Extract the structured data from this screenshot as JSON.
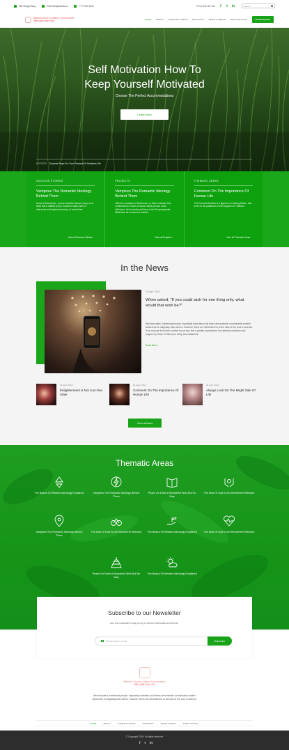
{
  "topbar": {
    "address": "365 Hunger Burg",
    "email": "Enter.info@samilo.ca",
    "phone": "+777 000 2019",
    "follow_label": "FOLLOW US ON",
    "social": [
      "f",
      "t",
      "in"
    ],
    "search_placeholder": "Search"
  },
  "nav": {
    "logo_line1": "National Trust for Nature Conservation",
    "logo_line2": "राष्ट्रिय प्रकृति संरक्षण कोष",
    "items": [
      "HOME",
      "ABOUT",
      "THEMATIC AREAS",
      "PROJECTS",
      "NEWS & MEDIA",
      "PUBLICATIONS"
    ],
    "cta": "Permit System"
  },
  "hero": {
    "title_line1": "Self Motivation How To",
    "title_line2": "Keep Yourself Motivated",
    "subtitle": "Choose The Perfect Accommodations",
    "button": "Learn More",
    "notices_label": "NOTICES",
    "notices_text": "Success Steps For Your Personal Or Business Life"
  },
  "columns": [
    {
      "heading": "SUCCESS STORIES",
      "title": "Vampires The Romantic Ideology Behind Them",
      "text": "Acres of Diamonds... you've read the famous story, or at least had it related to you. A farmer hears tales of diamonds and begins dreaming of vast riches.",
      "link": "View all Success Stories"
    },
    {
      "heading": "PROJECTS",
      "title": "Vampires The Romantic Ideology Behind Them",
      "text": "With the exception of Nietzsche, no other madman has contributed so much to human sanity as has Louis Althusser. He is mentioned twice in the Encyclopaedia Britannica as someone's teacher.",
      "link": "View all Projects"
    },
    {
      "heading": "THEMATIC AREAS",
      "title": "Comment On The Importance Of Human Life",
      "text": "The Emerald Buddha is a figurine of a sitting Budha, that is the is the palladium of the Kingdom of Thailand.",
      "link": "View all Thematic Areas"
    }
  ],
  "news": {
    "title": "In the News",
    "featured": {
      "date": "24 April, 2018",
      "title": "When asked, \"If you could wish for one thing only, what would that wish be?\"",
      "text": "Well educated, intellectual people, especially scientists at all times demonstrate considerably smaller adherence to religiosity than others. However, there are still believers of the idea of the God in science. If we exclude from their number those who feel a painful requirement for external protection and support by virtue of their poor living circumstances.",
      "more": "Read More"
    },
    "items": [
      {
        "date": "24 April, 2018",
        "title": "Enlightenment Is Not Just One State"
      },
      {
        "date": "24 April, 2018",
        "title": "Comment On The Importance Of Human Life"
      },
      {
        "date": "24 April, 2018",
        "title": "Always Look On The Bright Side Of Life"
      }
    ],
    "button": "View all News"
  },
  "thematic": {
    "title": "Thematic Areas",
    "items": [
      {
        "label": "The Basics Of Western Astrology Explained",
        "icon": "recycle-icon"
      },
      {
        "label": "Vampires The Romantic Ideology Behind Them",
        "icon": "energy-icon"
      },
      {
        "label": "Peace On Earth A Wonderful Wish But No Way",
        "icon": "book-icon"
      },
      {
        "label": "The Idea Of God Is Not Henceforth Relevant",
        "icon": "hands-icon"
      },
      {
        "label": "Vampires The Romantic Ideology Behind Them",
        "icon": "location-icon"
      },
      {
        "label": "The Idea Of God Is Not Henceforth Relevant",
        "icon": "cycle-icon"
      },
      {
        "label": "The Basics Of Western Astrology Explained",
        "icon": "plant-hand-icon"
      },
      {
        "label": "The Idea Of God Is Not Henceforth Relevant",
        "icon": "heartbeat-icon"
      },
      {
        "label": "Peace On Earth A Wonderful Wish But No Way",
        "icon": "temple-icon"
      },
      {
        "label": "The Basics Of Western Astrology Explained",
        "icon": "weather-icon"
      }
    ]
  },
  "newsletter": {
    "title": "Subscribe to our Newsletter",
    "subtitle": "Join our newsletter to stay on top of current information and events.",
    "placeholder": "Please fill your email",
    "button": "Subscribe"
  },
  "footer": {
    "logo_line1": "National Trust for Nature Conservation",
    "logo_line2": "राष्ट्रिय प्रकृति संरक्षण कोष",
    "description": "Well educated, intellectual people, especially scientists at all times demonstrate considerably smaller adherence to religiosity than others. However, there are still believers of the idea of the God in science.",
    "nav": [
      "HOME",
      "ABOUT",
      "THEMATIC AREAS",
      "PROJECTS",
      "NEWS & MEDIA",
      "PUBLICATIONS"
    ],
    "copyright": "© Copyright 2018. All rights reserved",
    "social": [
      "f",
      "t",
      "in"
    ]
  },
  "colors": {
    "brand_green": "#1aa51a",
    "dark_footer": "#2d2d2d"
  }
}
